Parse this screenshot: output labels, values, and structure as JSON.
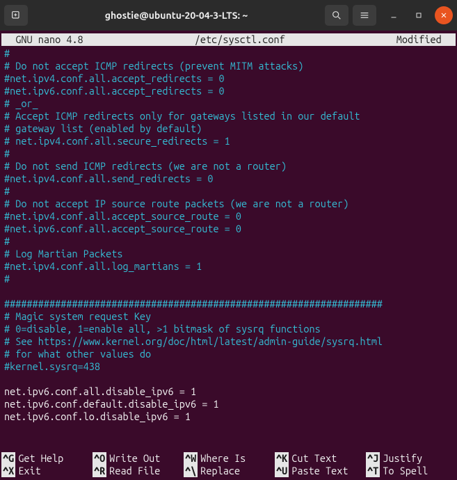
{
  "colors": {
    "bg": "#3a0a2a",
    "comment": "#34bcd4",
    "statusbar_bg": "#e6e6e6",
    "close_btn": "#e95420"
  },
  "titlebar": {
    "newtab_icon": "new-tab-icon",
    "title": "ghostie@ubuntu-20-04-3-LTS: ~",
    "search_icon": "search-icon",
    "menu_icon": "hamburger-icon",
    "min_icon": "minimize-icon",
    "max_icon": "maximize-icon",
    "close_icon": "close-icon"
  },
  "statusbar": {
    "app": "  GNU nano 4.8",
    "file": "/etc/sysctl.conf",
    "state": "Modified  "
  },
  "lines": [
    {
      "c": "cmt",
      "t": "#"
    },
    {
      "c": "cmt",
      "t": "# Do not accept ICMP redirects (prevent MITM attacks)"
    },
    {
      "c": "cmt",
      "t": "#net.ipv4.conf.all.accept_redirects = 0"
    },
    {
      "c": "cmt",
      "t": "#net.ipv6.conf.all.accept_redirects = 0"
    },
    {
      "c": "cmt",
      "t": "# _or_"
    },
    {
      "c": "cmt",
      "t": "# Accept ICMP redirects only for gateways listed in our default"
    },
    {
      "c": "cmt",
      "t": "# gateway list (enabled by default)"
    },
    {
      "c": "cmt",
      "t": "# net.ipv4.conf.all.secure_redirects = 1"
    },
    {
      "c": "cmt",
      "t": "#"
    },
    {
      "c": "cmt",
      "t": "# Do not send ICMP redirects (we are not a router)"
    },
    {
      "c": "cmt",
      "t": "#net.ipv4.conf.all.send_redirects = 0"
    },
    {
      "c": "cmt",
      "t": "#"
    },
    {
      "c": "cmt",
      "t": "# Do not accept IP source route packets (we are not a router)"
    },
    {
      "c": "cmt",
      "t": "#net.ipv4.conf.all.accept_source_route = 0"
    },
    {
      "c": "cmt",
      "t": "#net.ipv6.conf.all.accept_source_route = 0"
    },
    {
      "c": "cmt",
      "t": "#"
    },
    {
      "c": "cmt",
      "t": "# Log Martian Packets"
    },
    {
      "c": "cmt",
      "t": "#net.ipv4.conf.all.log_martians = 1"
    },
    {
      "c": "cmt",
      "t": "#"
    },
    {
      "c": "plain",
      "t": ""
    },
    {
      "c": "cmt",
      "t": "###################################################################"
    },
    {
      "c": "cmt",
      "t": "# Magic system request Key"
    },
    {
      "c": "cmt",
      "t": "# 0=disable, 1=enable all, >1 bitmask of sysrq functions"
    },
    {
      "c": "cmt",
      "t": "# See https://www.kernel.org/doc/html/latest/admin-guide/sysrq.html"
    },
    {
      "c": "cmt",
      "t": "# for what other values do"
    },
    {
      "c": "cmt",
      "t": "#kernel.sysrq=438"
    },
    {
      "c": "plain",
      "t": ""
    },
    {
      "c": "plain",
      "t": "net.ipv6.conf.all.disable_ipv6 = 1"
    },
    {
      "c": "plain",
      "t": "net.ipv6.conf.default.disable_ipv6 = 1"
    },
    {
      "c": "plain",
      "t": "net.ipv6.conf.lo.disable_ipv6 = 1"
    }
  ],
  "shortcuts": [
    {
      "key": "^G",
      "label": "Get Help"
    },
    {
      "key": "^O",
      "label": "Write Out"
    },
    {
      "key": "^W",
      "label": "Where Is"
    },
    {
      "key": "^K",
      "label": "Cut Text"
    },
    {
      "key": "^J",
      "label": "Justify"
    },
    {
      "key": "^X",
      "label": "Exit"
    },
    {
      "key": "^R",
      "label": "Read File"
    },
    {
      "key": "^\\",
      "label": "Replace"
    },
    {
      "key": "^U",
      "label": "Paste Text"
    },
    {
      "key": "^T",
      "label": "To Spell"
    }
  ]
}
